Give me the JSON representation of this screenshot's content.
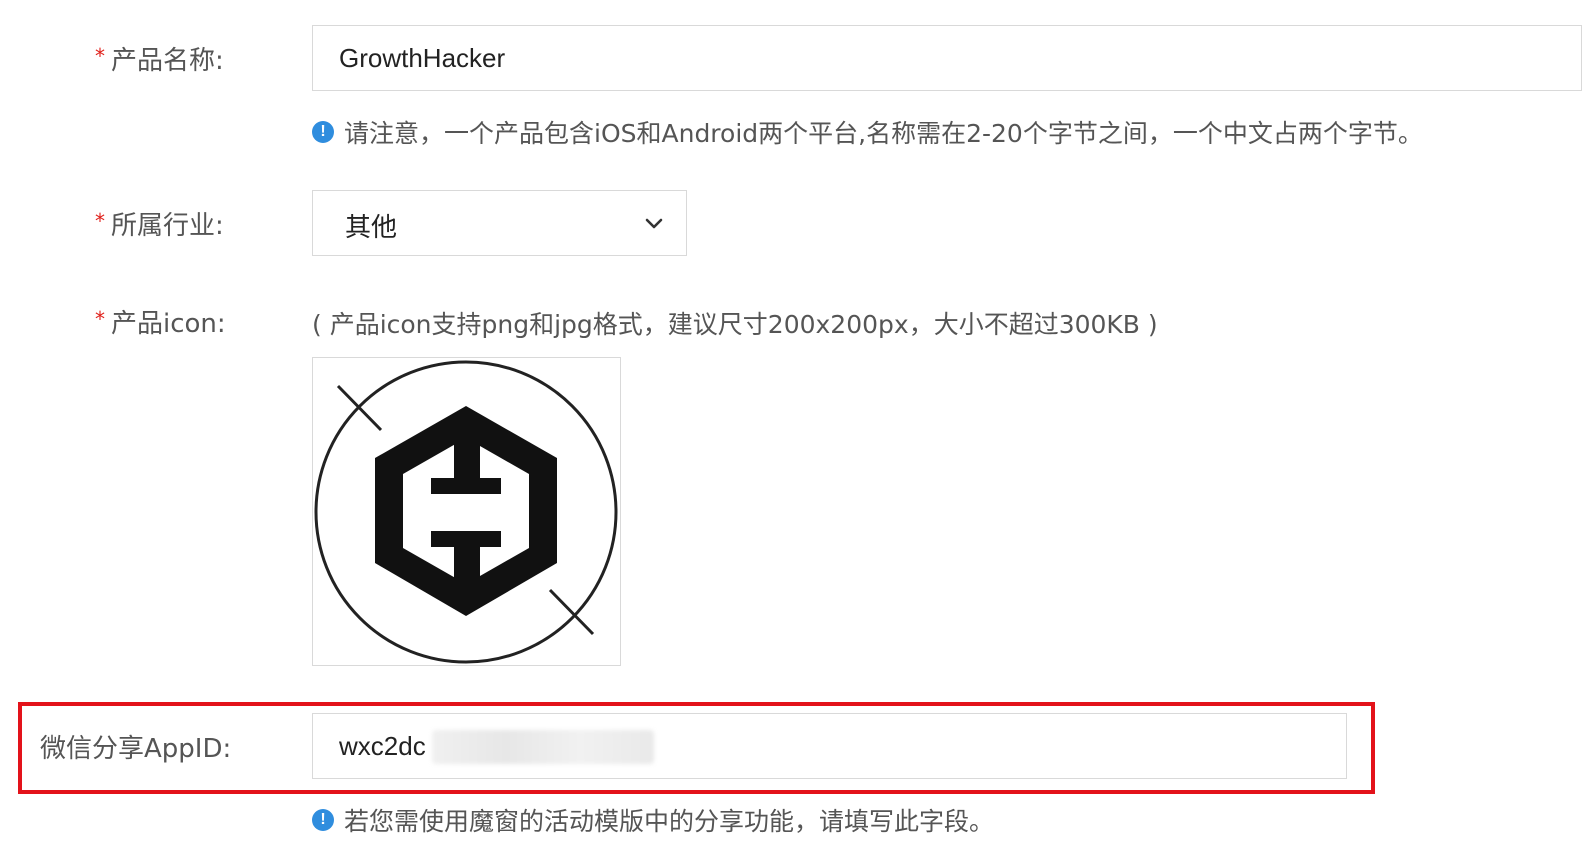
{
  "form": {
    "product_name": {
      "required_mark": "*",
      "label": "产品名称:",
      "value": "GrowthHacker",
      "hint": "请注意，一个产品包含iOS和Android两个平台,名称需在2-20个字节之间，一个中文占两个字节。"
    },
    "industry": {
      "required_mark": "*",
      "label": "所属行业:",
      "selected": "其他"
    },
    "product_icon": {
      "required_mark": "*",
      "label": "产品icon:",
      "hint": "( 产品icon支持png和jpg格式，建议尺寸200x200px，大小不超过300KB )",
      "icon_name": "growthhacker-logo-icon"
    },
    "wechat_appid": {
      "label": "微信分享AppID:",
      "value": "wxc2dc",
      "hint": "若您需使用魔窗的活动模版中的分享功能，请填写此字段。"
    },
    "info_icon_glyph": "!"
  },
  "colors": {
    "required": "#e0201a",
    "info": "#2f8dde",
    "highlight_border": "#e3121a",
    "input_border": "#d9d9d9"
  }
}
